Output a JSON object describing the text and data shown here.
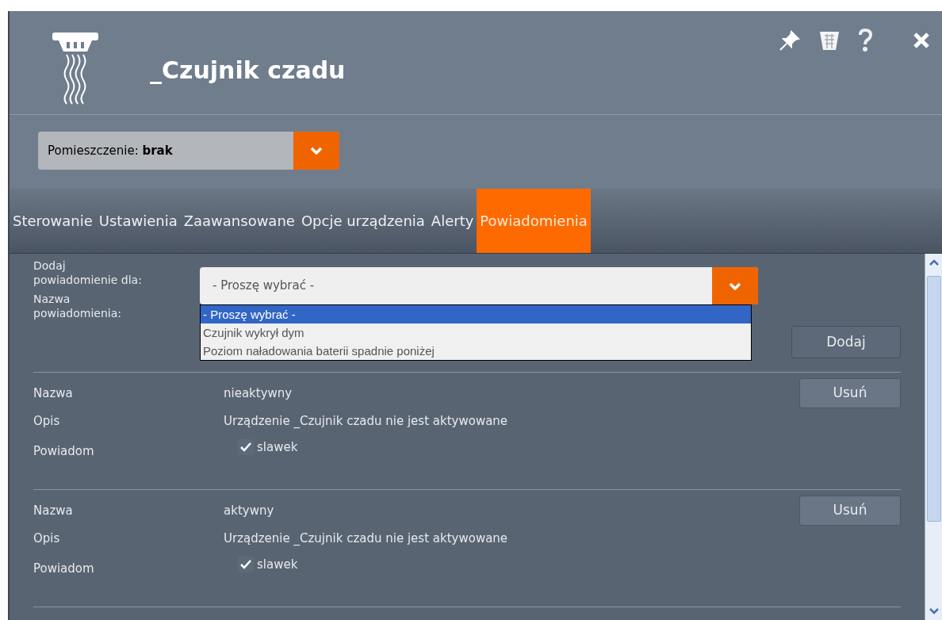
{
  "window": {
    "title": "_Czujnik czadu"
  },
  "room": {
    "label": "Pomieszczenie:",
    "value": "brak"
  },
  "tabs": [
    {
      "label": "Sterowanie",
      "selected": false
    },
    {
      "label": "Ustawienia",
      "selected": false
    },
    {
      "label": "Zaawansowane",
      "selected": false
    },
    {
      "label": "Opcje urządzenia",
      "selected": false
    },
    {
      "label": "Alerty",
      "selected": false
    },
    {
      "label": "Powiadomienia",
      "selected": true
    }
  ],
  "add_form": {
    "event_label": "Dodaj powiadomienie dla:",
    "event_value": "- Proszę wybrać -",
    "name_label": "Nazwa powiadomienia:",
    "add_button": "Dodaj",
    "options": [
      {
        "label": "- Proszę wybrać -",
        "selected": true
      },
      {
        "label": "Czujnik wykrył dym",
        "selected": false
      },
      {
        "label": "Poziom naładowania baterii spadnie poniżej",
        "selected": false
      }
    ]
  },
  "notifications": [
    {
      "name_label": "Nazwa",
      "name": "nieaktywny",
      "remove_button": "Usuń",
      "description_label": "Opis",
      "description": "Urządzenie _Czujnik czadu nie jest aktywowane",
      "notify_label": "Powiadom",
      "recipients": [
        {
          "label": "slawek",
          "checked": true
        }
      ]
    },
    {
      "name_label": "Nazwa",
      "name": "aktywny",
      "remove_button": "Usuń",
      "description_label": "Opis",
      "description": "Urządzenie _Czujnik czadu nie jest aktywowane",
      "notify_label": "Powiadom",
      "recipients": [
        {
          "label": "slawek",
          "checked": true
        }
      ]
    }
  ]
}
